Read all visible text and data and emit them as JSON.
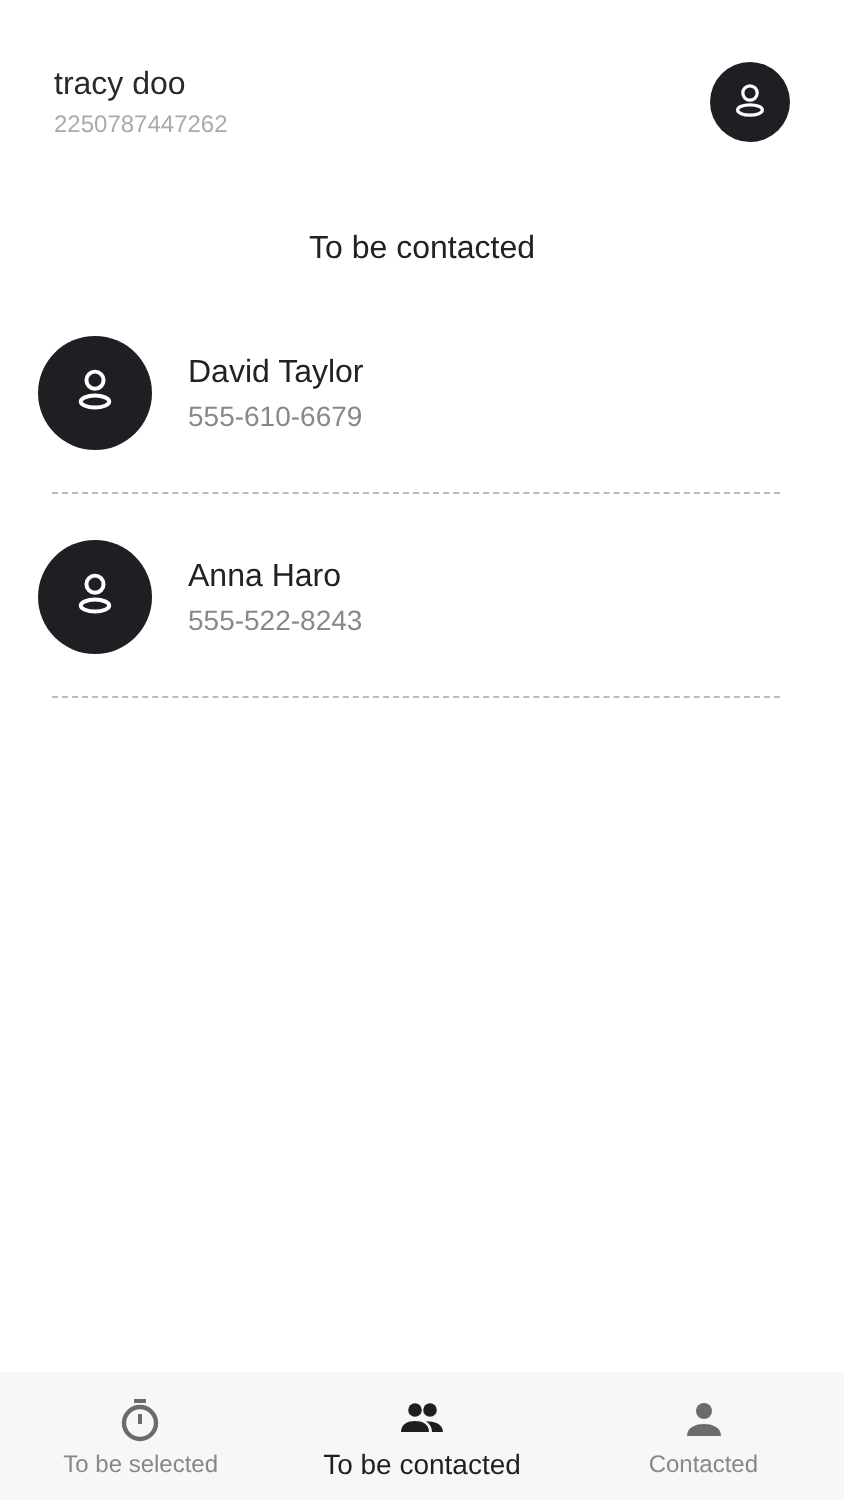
{
  "profile": {
    "name": "tracy doo",
    "number": "2250787447262"
  },
  "title": "To be contacted",
  "contacts": [
    {
      "name": "David Taylor",
      "phone": "555-610-6679"
    },
    {
      "name": "Anna Haro",
      "phone": "555-522-8243"
    }
  ],
  "tabs": [
    {
      "label": "To be selected",
      "kind": "timer",
      "selected": false
    },
    {
      "label": "To be contacted",
      "kind": "group",
      "selected": true
    },
    {
      "label": "Contacted",
      "kind": "person",
      "selected": false
    }
  ]
}
